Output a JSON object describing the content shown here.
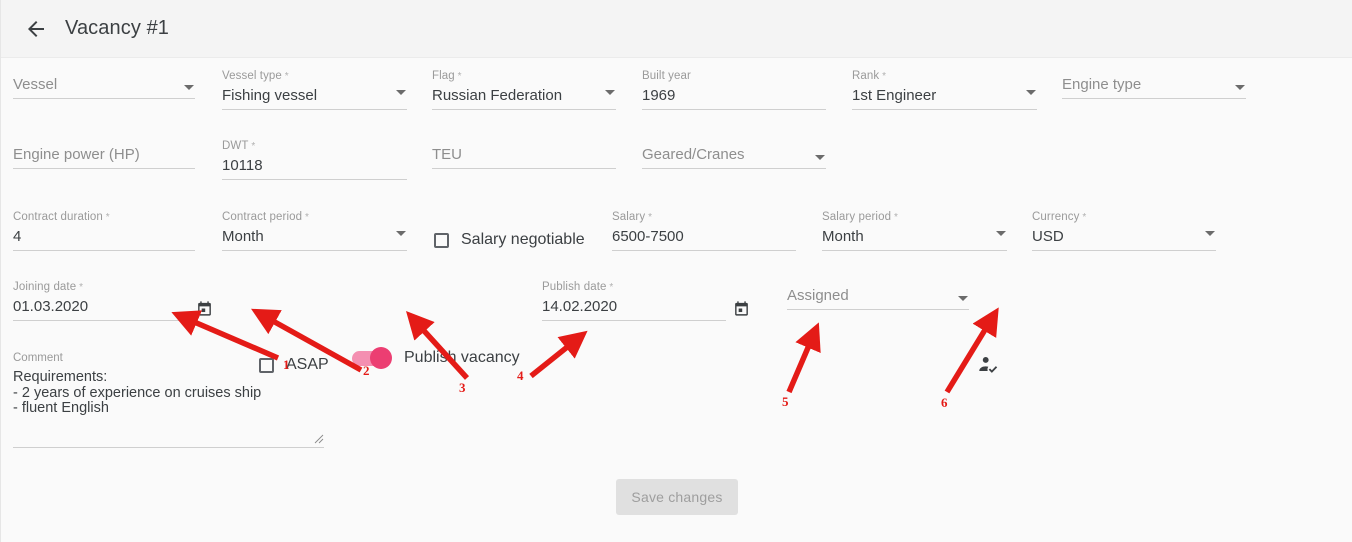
{
  "header": {
    "back_icon": "arrow-left-icon",
    "title": "Vacancy #1"
  },
  "form": {
    "vessel": {
      "label": "Vessel",
      "value": "Vessel",
      "is_placeholder": true,
      "required": false,
      "type": "select"
    },
    "vessel_type": {
      "label": "Vessel type",
      "value": "Fishing vessel",
      "is_placeholder": false,
      "required": true,
      "type": "select"
    },
    "flag": {
      "label": "Flag",
      "value": "Russian Federation",
      "is_placeholder": false,
      "required": true,
      "type": "select"
    },
    "built_year": {
      "label": "Built year",
      "value": "1969",
      "is_placeholder": false,
      "required": false,
      "type": "text"
    },
    "rank": {
      "label": "Rank",
      "value": "1st Engineer",
      "is_placeholder": false,
      "required": true,
      "type": "select"
    },
    "engine_type": {
      "label": "Engine type",
      "value": "Engine type",
      "is_placeholder": true,
      "required": false,
      "type": "select"
    },
    "engine_power": {
      "label": "Engine power (HP)",
      "value": "Engine power (HP)",
      "is_placeholder": true,
      "required": false,
      "type": "text"
    },
    "dwt": {
      "label": "DWT",
      "value": "10118",
      "is_placeholder": false,
      "required": true,
      "type": "text"
    },
    "teu": {
      "label": "TEU",
      "value": "TEU",
      "is_placeholder": true,
      "required": false,
      "type": "text"
    },
    "geared_cranes": {
      "label": "Geared/Cranes",
      "value": "Geared/Cranes",
      "is_placeholder": true,
      "required": false,
      "type": "select"
    },
    "contract_duration": {
      "label": "Contract duration",
      "value": "4",
      "is_placeholder": false,
      "required": true,
      "type": "text"
    },
    "contract_period": {
      "label": "Contract period",
      "value": "Month",
      "is_placeholder": false,
      "required": true,
      "type": "select"
    },
    "salary_negotiable": {
      "label": "Salary negotiable",
      "checked": false
    },
    "salary": {
      "label": "Salary",
      "value": "6500-7500",
      "is_placeholder": false,
      "required": true,
      "type": "text"
    },
    "salary_period": {
      "label": "Salary period",
      "value": "Month",
      "is_placeholder": false,
      "required": true,
      "type": "select"
    },
    "currency": {
      "label": "Currency",
      "value": "USD",
      "is_placeholder": false,
      "required": true,
      "type": "select"
    },
    "joining_date": {
      "label": "Joining date",
      "value": "01.03.2020",
      "is_placeholder": false,
      "required": true,
      "type": "date",
      "icon": "calendar-icon"
    },
    "asap": {
      "label": "ASAP",
      "checked": false
    },
    "publish_vacancy": {
      "label": "Publish vacancy",
      "checked": true,
      "track_color": "#f48fb1",
      "knob_color": "#ec3e72"
    },
    "publish_date": {
      "label": "Publish date",
      "value": "14.02.2020",
      "is_placeholder": false,
      "required": true,
      "type": "date",
      "icon": "calendar-icon"
    },
    "assigned": {
      "label": "Assigned",
      "value": "Assigned",
      "is_placeholder": true,
      "required": false,
      "type": "select"
    },
    "assign_person": {
      "icon": "person-check-icon"
    },
    "comment": {
      "label": "Comment",
      "value": "Requirements:\n- 2 years of experience on cruises ship\n- fluent English",
      "is_placeholder": false
    }
  },
  "footer": {
    "save_label": "Save changes",
    "save_disabled": true
  },
  "annotations": {
    "color": "#e41b17",
    "markers": [
      {
        "id": "1",
        "target": "joining-date-field"
      },
      {
        "id": "2",
        "target": "asap-checkbox"
      },
      {
        "id": "3",
        "target": "publish-vacancy-toggle"
      },
      {
        "id": "4",
        "target": "publish-date-field"
      },
      {
        "id": "5",
        "target": "assigned-select"
      },
      {
        "id": "6",
        "target": "assign-person-icon"
      }
    ],
    "labels": {
      "m1": "1",
      "m2": "2",
      "m3": "3",
      "m4": "4",
      "m5": "5",
      "m6": "6"
    }
  }
}
